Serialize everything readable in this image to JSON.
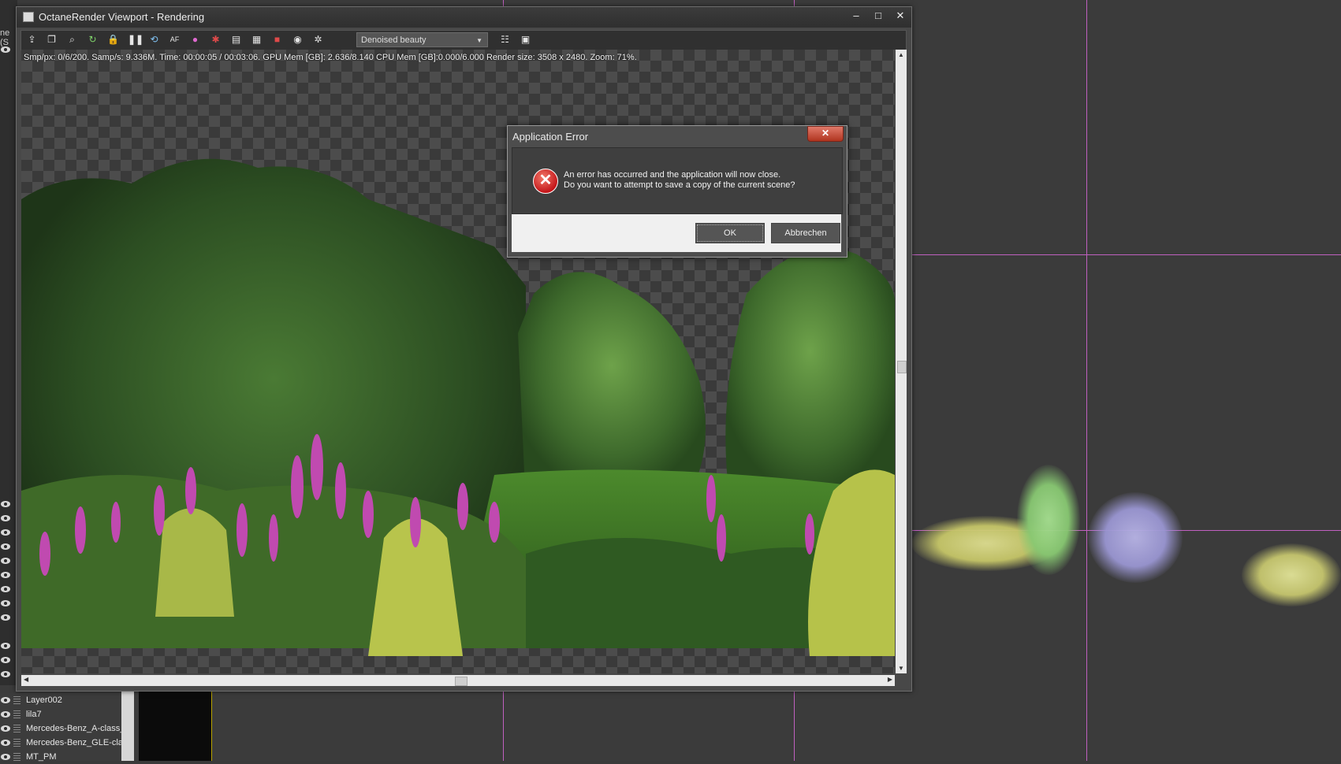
{
  "window": {
    "title": "OctaneRender Viewport - Rendering",
    "controls": {
      "minimize": "–",
      "maximize": "□",
      "close": "✕"
    }
  },
  "toolbar": {
    "icons": [
      "import-icon",
      "copy-icon",
      "zoom-icon",
      "refresh-icon",
      "lock-icon",
      "pause-icon",
      "restart-icon",
      "af-icon",
      "color-icon",
      "material-icon",
      "screen-icon",
      "region-icon",
      "render-icon",
      "camera-icon",
      "settings-icon",
      "list-icon",
      "image-icon"
    ],
    "af_label": "AF",
    "pass_select": "Denoised beauty"
  },
  "status": {
    "text": "Smp/px: 0/6/200.   Samp/s: 9.336M.   Time: 00:00:05 / 00:03:06.   GPU Mem [GB]: 2.636/8.140   CPU Mem [GB]:0.000/6.000   Render size: 3508 x 2480.   Zoom: 71%."
  },
  "dialog": {
    "title": "Application Error",
    "close": "✕",
    "message_line1": "An error has occurred and the application will now close.",
    "message_line2": "Do you want to attempt to save a copy of the current scene?",
    "ok": "OK",
    "cancel": "Abbrechen"
  },
  "left_panel": {
    "top_text": "ne (S"
  },
  "layers": [
    "Layer002",
    "lila7",
    "Mercedes-Benz_A-class_",
    "Mercedes-Benz_GLE-clas",
    "MT_PM"
  ]
}
